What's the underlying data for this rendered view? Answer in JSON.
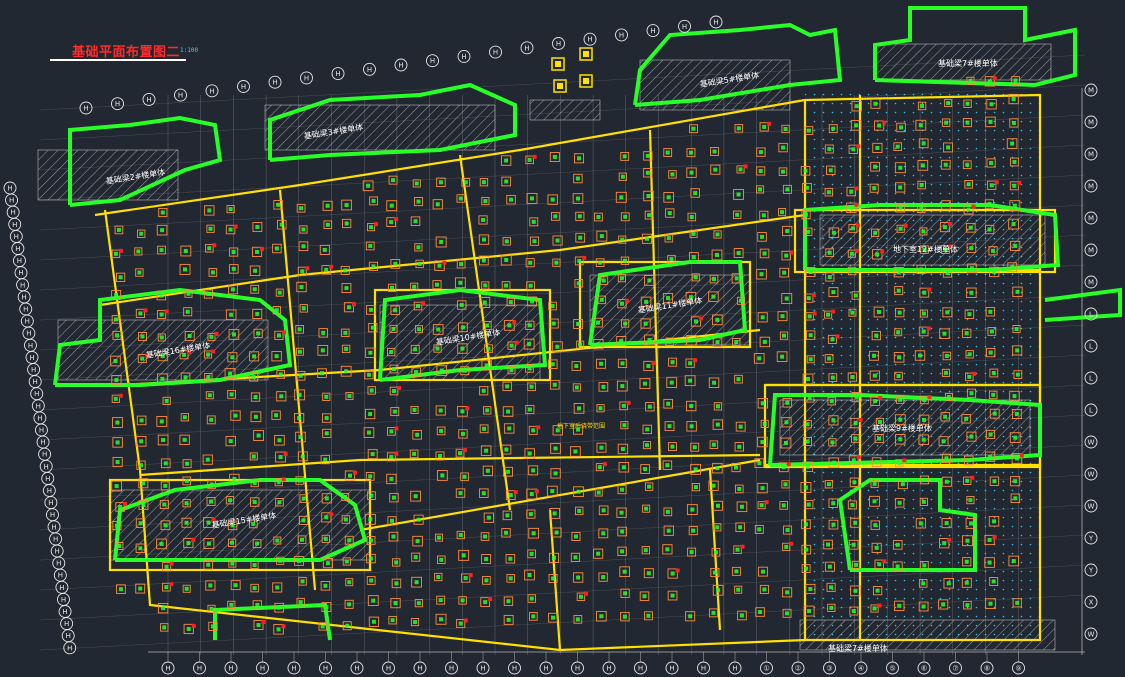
{
  "drawing": {
    "title": "基础平面布置图二",
    "scale": "1:100"
  },
  "colors": {
    "background": "#222831",
    "grid_line": "#b5b5b5",
    "foundation_beam": "#ffe000",
    "shear_wall": "#27ff27",
    "pile_cap": "#ff8c3a",
    "column": "#ff2020",
    "pile_marker": "#35d4ff",
    "axis_bubble": "#e8e8e8",
    "title_text": "#ff2a2a"
  },
  "icons": {
    "axis_bubble": "circle-axis-icon",
    "pile_cap": "pile-cap-icon",
    "column": "column-icon"
  },
  "zone_labels": [
    {
      "id": "z1",
      "text": "基础梁2#楼单体"
    },
    {
      "id": "z2",
      "text": "基础梁3#楼单体"
    },
    {
      "id": "z3",
      "text": "基础梁5#楼单体"
    },
    {
      "id": "z4",
      "text": "基础梁7#楼单体"
    },
    {
      "id": "z5",
      "text": "地下室12#楼单体"
    },
    {
      "id": "z6",
      "text": "基础梁11#楼单体"
    },
    {
      "id": "z7",
      "text": "基础梁10#楼单体"
    },
    {
      "id": "z8",
      "text": "基础梁16#楼单体"
    },
    {
      "id": "z9",
      "text": "基础梁9#楼单体"
    },
    {
      "id": "z10",
      "text": "基础梁15#楼单体"
    },
    {
      "id": "z11",
      "text": "基础梁7#楼单体"
    }
  ],
  "notes": [
    {
      "id": "n1",
      "text": "地下室后浇带范围"
    }
  ],
  "axes": {
    "bottom": [
      "H",
      "H",
      "H",
      "H",
      "H",
      "H",
      "H",
      "H",
      "H",
      "H",
      "H",
      "H",
      "H",
      "H",
      "H",
      "H",
      "H",
      "H",
      "H",
      "①",
      "②",
      "③",
      "④",
      "⑤",
      "⑥",
      "⑦",
      "⑧",
      "⑨",
      "⑩"
    ],
    "right": [
      "M",
      "M",
      "M",
      "M",
      "M",
      "M",
      "M",
      "L",
      "L",
      "L",
      "L",
      "W",
      "W",
      "W",
      "Y",
      "Y",
      "X",
      "W"
    ],
    "left": [
      "H",
      "H",
      "H",
      "H",
      "H",
      "H",
      "H",
      "H",
      "H",
      "H",
      "H",
      "H",
      "H",
      "H",
      "H",
      "H",
      "H",
      "H",
      "H",
      "H",
      "H",
      "H",
      "H",
      "H",
      "H",
      "H",
      "H",
      "H",
      "H",
      "H",
      "H",
      "H",
      "H",
      "H",
      "H",
      "H",
      "H",
      "H",
      "H"
    ],
    "top": [
      "H",
      "H",
      "H",
      "H",
      "H",
      "H",
      "H",
      "H",
      "H",
      "H",
      "H",
      "H",
      "H",
      "H",
      "H",
      "H",
      "H",
      "H",
      "H",
      "H",
      "H",
      "H",
      "H"
    ]
  }
}
